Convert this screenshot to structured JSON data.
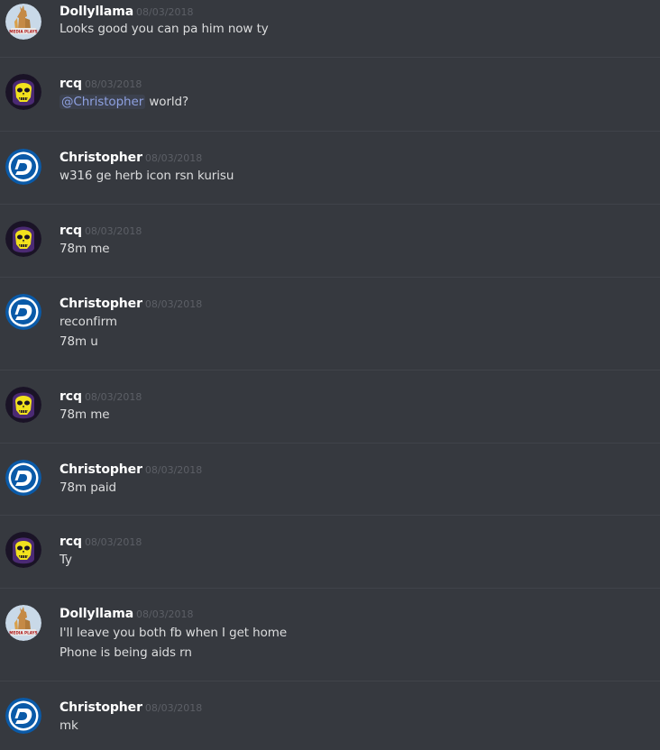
{
  "users": {
    "dolly": {
      "name": "Dollyllama",
      "avatar_icon": "llama-avatar-icon",
      "avatar_caption": "MEDIA PLAYS"
    },
    "rcq": {
      "name": "rcq",
      "avatar_icon": "skeletor-skull-avatar-icon"
    },
    "chris": {
      "name": "Christopher",
      "avatar_icon": "digibyte-d-logo-avatar-icon"
    }
  },
  "colors": {
    "background": "#36393f",
    "divider": "#40434a",
    "author": "#ffffff",
    "message_text": "#dcddde",
    "timestamp": "#5c5f66",
    "mention": "#8ea1e1",
    "digibyte_blue": "#0a5aa8",
    "skull_yellow": "#f2e21d"
  },
  "messages": [
    {
      "author": "Dollyllama",
      "timestamp": "08/03/2018",
      "lines": [
        "Looks good you can pa him now ty"
      ]
    },
    {
      "author": "rcq",
      "timestamp": "08/03/2018",
      "mention": "@Christopher",
      "after_mention": " world?"
    },
    {
      "author": "Christopher",
      "timestamp": "08/03/2018",
      "lines": [
        "w316 ge herb icon rsn kurisu"
      ]
    },
    {
      "author": "rcq",
      "timestamp": "08/03/2018",
      "lines": [
        "78m me"
      ]
    },
    {
      "author": "Christopher",
      "timestamp": "08/03/2018",
      "lines": [
        "reconfirm",
        "78m u"
      ]
    },
    {
      "author": "rcq",
      "timestamp": "08/03/2018",
      "lines": [
        "78m me"
      ]
    },
    {
      "author": "Christopher",
      "timestamp": "08/03/2018",
      "lines": [
        "78m paid"
      ]
    },
    {
      "author": "rcq",
      "timestamp": "08/03/2018",
      "lines": [
        "Ty"
      ]
    },
    {
      "author": "Dollyllama",
      "timestamp": "08/03/2018",
      "lines": [
        "I'll leave you both fb when I get home",
        "Phone is being aids rn"
      ]
    },
    {
      "author": "Christopher",
      "timestamp": "08/03/2018",
      "lines": [
        "mk"
      ]
    }
  ]
}
